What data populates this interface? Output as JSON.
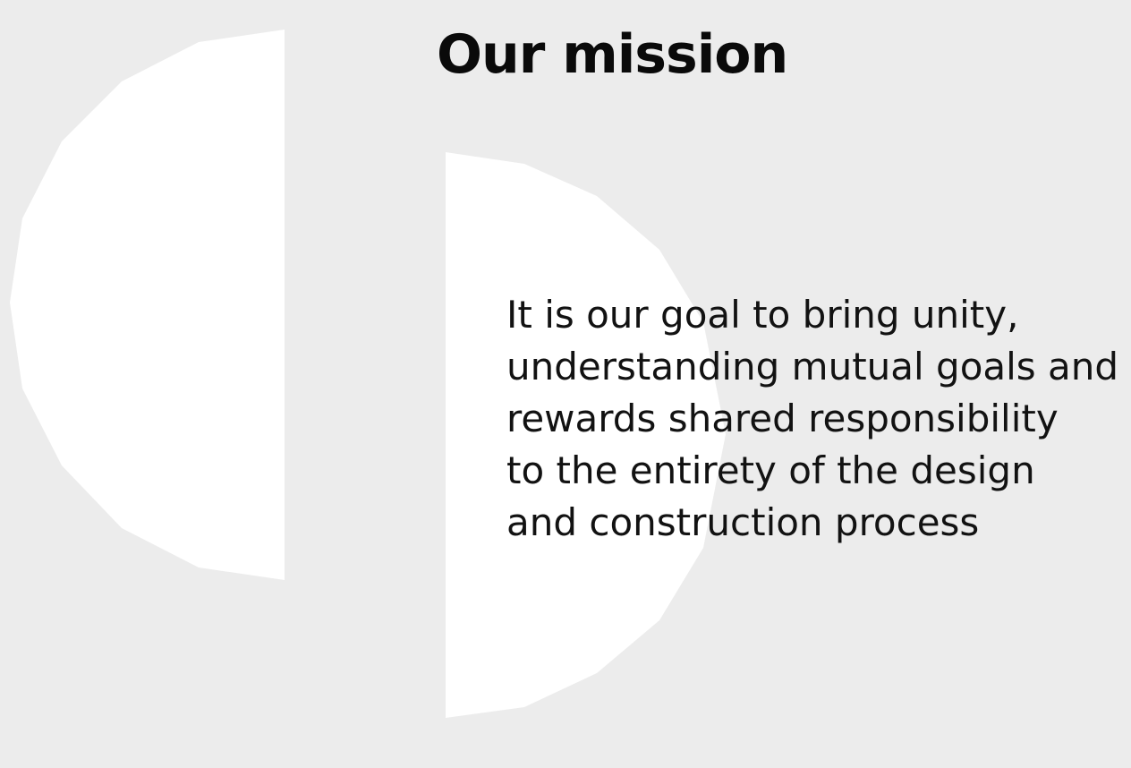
{
  "mission": {
    "title": "Our mission",
    "lines": [
      "It is our goal to bring unity,",
      "understanding mutual goals and",
      "rewards shared responsibility",
      "to the entirety of the design",
      "and construction process"
    ]
  },
  "colors": {
    "background": "#ececec",
    "shapes": "#ffffff",
    "text": "#0a0a0a"
  }
}
